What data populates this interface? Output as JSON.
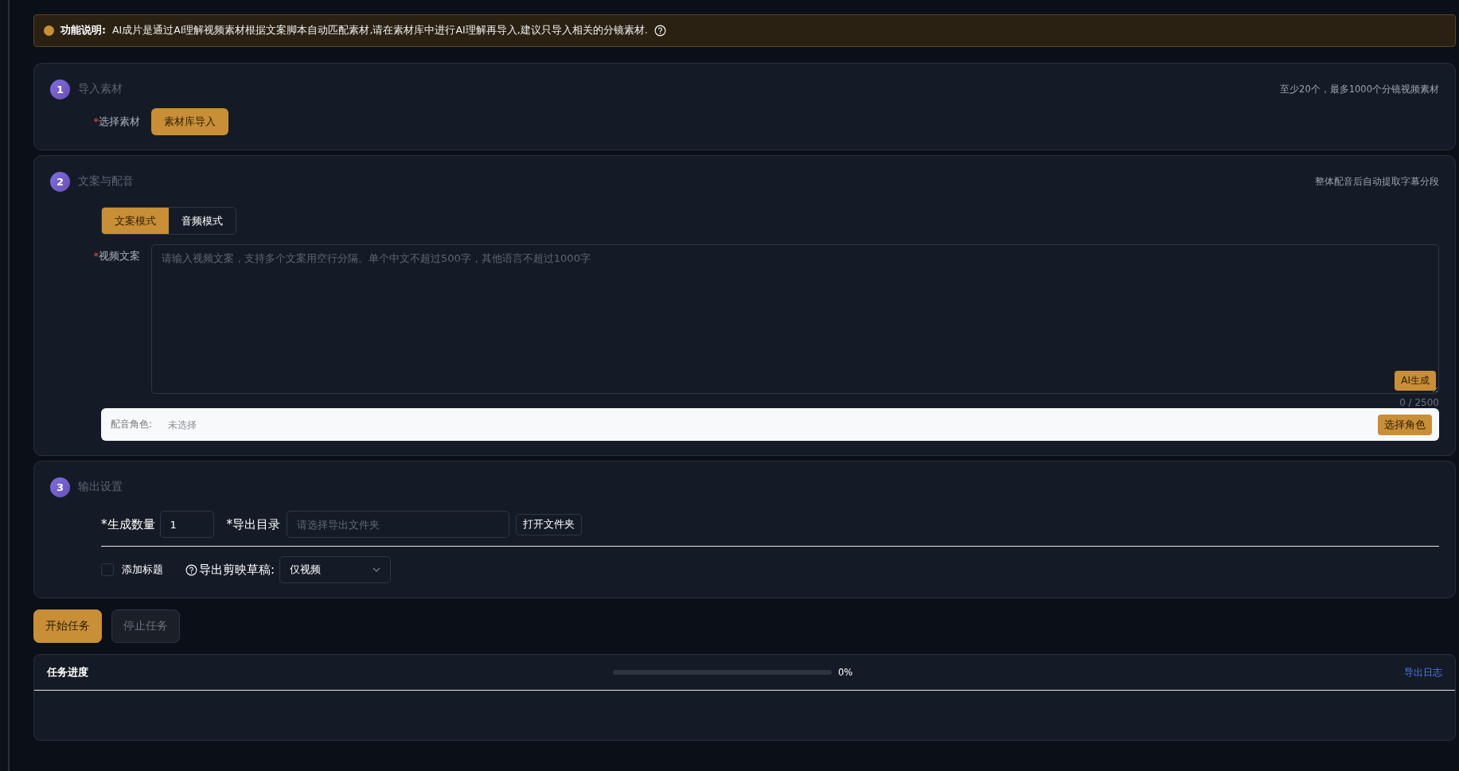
{
  "notice": {
    "label": "功能说明:",
    "text": "AI成片是通过AI理解视频素材根据文案脚本自动匹配素材,请在素材库中进行AI理解再导入,建议只导入相关的分镜素材."
  },
  "sections": [
    {
      "number": "1",
      "title": "导入素材",
      "hint": "至少20个，最多1000个分镜视频素材"
    },
    {
      "number": "2",
      "title": "文案与配音",
      "hint": "整体配音后自动提取字幕分段"
    },
    {
      "number": "3",
      "title": "输出设置"
    }
  ],
  "material": {
    "mark": "*",
    "label": "选择素材",
    "button": "素材库导入"
  },
  "script_modes": [
    {
      "label": "文案模式",
      "selected": true
    },
    {
      "label": "音频模式",
      "selected": false
    }
  ],
  "script": {
    "mark": "*",
    "label": "视频文案",
    "placeholder": "请输入视频文案，支持多个文案用空行分隔。单个中文不超过500字，其他语言不超过1000字",
    "ai_button": "AI生成",
    "count": "0 / 2500"
  },
  "voice": {
    "label": "配音角色:",
    "placeholder": "未选择",
    "button": "选择角色"
  },
  "output": {
    "count_label": "*生成数量",
    "count_value": "1",
    "dir_label": "*导出目录",
    "dir_placeholder": "请选择导出文件夹",
    "open_button": "打开文件夹",
    "add_title": {
      "label": "添加标题",
      "checked": false
    },
    "draft_label": "导出剪映草稿:",
    "draft_value": "仅视频"
  },
  "actions": [
    {
      "label": "开始任务",
      "disabled": false
    },
    {
      "label": "停止任务",
      "disabled": true
    }
  ],
  "progress": {
    "title": "任务进度",
    "level": 0,
    "reading": "0%",
    "link": "导出日志"
  }
}
